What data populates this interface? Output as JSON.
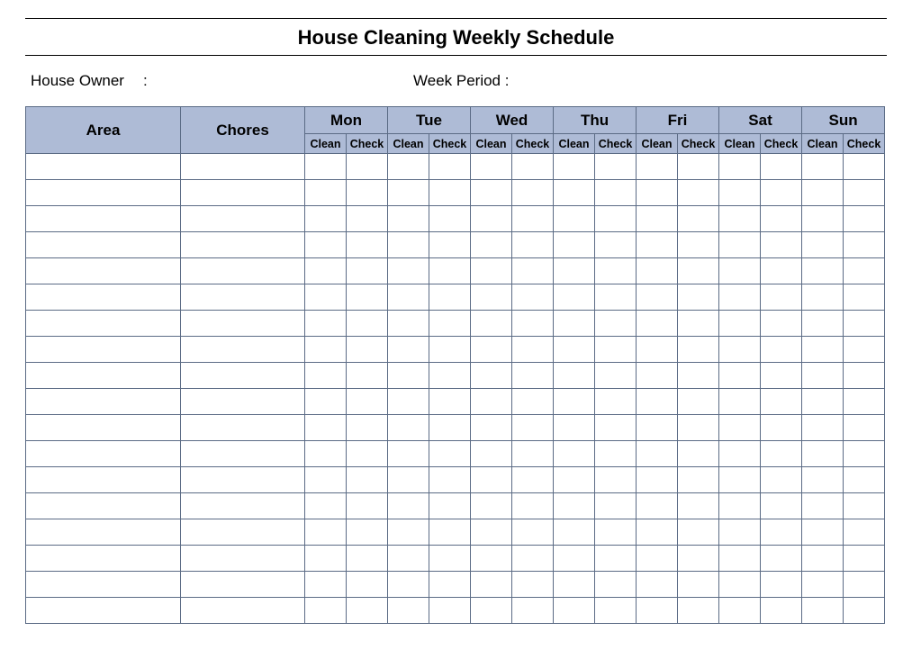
{
  "title": "House Cleaning Weekly Schedule",
  "meta": {
    "owner_label": "House Owner",
    "owner_colon": ":",
    "owner_value": "",
    "week_label": "Week  Period :",
    "week_value": ""
  },
  "headers": {
    "area": "Area",
    "chores": "Chores",
    "days": [
      "Mon",
      "Tue",
      "Wed",
      "Thu",
      "Fri",
      "Sat",
      "Sun"
    ],
    "sub": [
      "Clean",
      "Check"
    ]
  },
  "rows": [
    {
      "area": "",
      "chores": "",
      "cells": [
        "",
        "",
        "",
        "",
        "",
        "",
        "",
        "",
        "",
        "",
        "",
        "",
        "",
        ""
      ]
    },
    {
      "area": "",
      "chores": "",
      "cells": [
        "",
        "",
        "",
        "",
        "",
        "",
        "",
        "",
        "",
        "",
        "",
        "",
        "",
        ""
      ]
    },
    {
      "area": "",
      "chores": "",
      "cells": [
        "",
        "",
        "",
        "",
        "",
        "",
        "",
        "",
        "",
        "",
        "",
        "",
        "",
        ""
      ]
    },
    {
      "area": "",
      "chores": "",
      "cells": [
        "",
        "",
        "",
        "",
        "",
        "",
        "",
        "",
        "",
        "",
        "",
        "",
        "",
        ""
      ]
    },
    {
      "area": "",
      "chores": "",
      "cells": [
        "",
        "",
        "",
        "",
        "",
        "",
        "",
        "",
        "",
        "",
        "",
        "",
        "",
        ""
      ]
    },
    {
      "area": "",
      "chores": "",
      "cells": [
        "",
        "",
        "",
        "",
        "",
        "",
        "",
        "",
        "",
        "",
        "",
        "",
        "",
        ""
      ]
    },
    {
      "area": "",
      "chores": "",
      "cells": [
        "",
        "",
        "",
        "",
        "",
        "",
        "",
        "",
        "",
        "",
        "",
        "",
        "",
        ""
      ]
    },
    {
      "area": "",
      "chores": "",
      "cells": [
        "",
        "",
        "",
        "",
        "",
        "",
        "",
        "",
        "",
        "",
        "",
        "",
        "",
        ""
      ]
    },
    {
      "area": "",
      "chores": "",
      "cells": [
        "",
        "",
        "",
        "",
        "",
        "",
        "",
        "",
        "",
        "",
        "",
        "",
        "",
        ""
      ]
    },
    {
      "area": "",
      "chores": "",
      "cells": [
        "",
        "",
        "",
        "",
        "",
        "",
        "",
        "",
        "",
        "",
        "",
        "",
        "",
        ""
      ]
    },
    {
      "area": "",
      "chores": "",
      "cells": [
        "",
        "",
        "",
        "",
        "",
        "",
        "",
        "",
        "",
        "",
        "",
        "",
        "",
        ""
      ]
    },
    {
      "area": "",
      "chores": "",
      "cells": [
        "",
        "",
        "",
        "",
        "",
        "",
        "",
        "",
        "",
        "",
        "",
        "",
        "",
        ""
      ]
    },
    {
      "area": "",
      "chores": "",
      "cells": [
        "",
        "",
        "",
        "",
        "",
        "",
        "",
        "",
        "",
        "",
        "",
        "",
        "",
        ""
      ]
    },
    {
      "area": "",
      "chores": "",
      "cells": [
        "",
        "",
        "",
        "",
        "",
        "",
        "",
        "",
        "",
        "",
        "",
        "",
        "",
        ""
      ]
    },
    {
      "area": "",
      "chores": "",
      "cells": [
        "",
        "",
        "",
        "",
        "",
        "",
        "",
        "",
        "",
        "",
        "",
        "",
        "",
        ""
      ]
    },
    {
      "area": "",
      "chores": "",
      "cells": [
        "",
        "",
        "",
        "",
        "",
        "",
        "",
        "",
        "",
        "",
        "",
        "",
        "",
        ""
      ]
    },
    {
      "area": "",
      "chores": "",
      "cells": [
        "",
        "",
        "",
        "",
        "",
        "",
        "",
        "",
        "",
        "",
        "",
        "",
        "",
        ""
      ]
    },
    {
      "area": "",
      "chores": "",
      "cells": [
        "",
        "",
        "",
        "",
        "",
        "",
        "",
        "",
        "",
        "",
        "",
        "",
        "",
        ""
      ]
    }
  ],
  "chart_data": {
    "type": "table",
    "title": "House Cleaning Weekly Schedule",
    "columns": [
      "Area",
      "Chores",
      "Mon Clean",
      "Mon Check",
      "Tue Clean",
      "Tue Check",
      "Wed Clean",
      "Wed Check",
      "Thu Clean",
      "Thu Check",
      "Fri Clean",
      "Fri Check",
      "Sat Clean",
      "Sat Check",
      "Sun Clean",
      "Sun Check"
    ],
    "rows": []
  },
  "colors": {
    "header_bg": "#aebbd6",
    "border": "#5b6b85"
  }
}
